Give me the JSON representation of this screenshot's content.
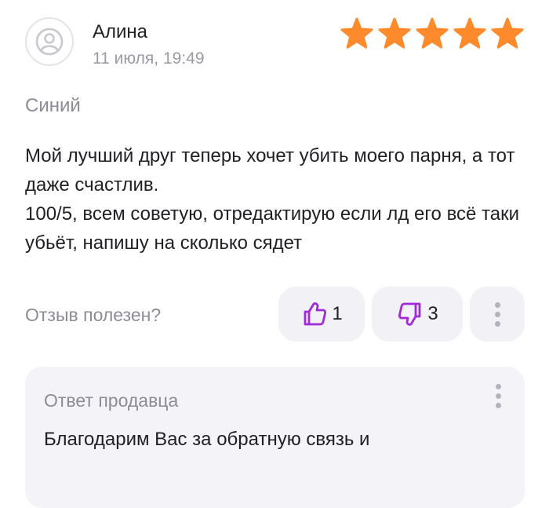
{
  "review": {
    "author": "Алина",
    "date": "11 июля, 19:49",
    "rating": 5,
    "rating_max": 5,
    "variant": "Синий",
    "text_lines": [
      "Мой лучший друг теперь хочет убить моего парня, а тот даже счастлив.",
      "100/5, всем советую, отредактирую если лд его всё таки убьёт, напишу на сколько сядет"
    ],
    "helpful_question": "Отзыв полезен?",
    "likes": "1",
    "dislikes": "3"
  },
  "seller_reply": {
    "title": "Ответ продавца",
    "text": "Благодарим Вас за обратную связь и"
  },
  "colors": {
    "star": "#ff8a2b",
    "thumb_accent": "#a02bd9",
    "muted_text": "#8c8c97",
    "pill_bg": "#f1f1f6"
  },
  "icons": {
    "avatar": "user-avatar-icon",
    "star": "star-icon",
    "like": "thumb-up-icon",
    "dislike": "thumb-down-icon",
    "more": "more-vertical-icon"
  }
}
